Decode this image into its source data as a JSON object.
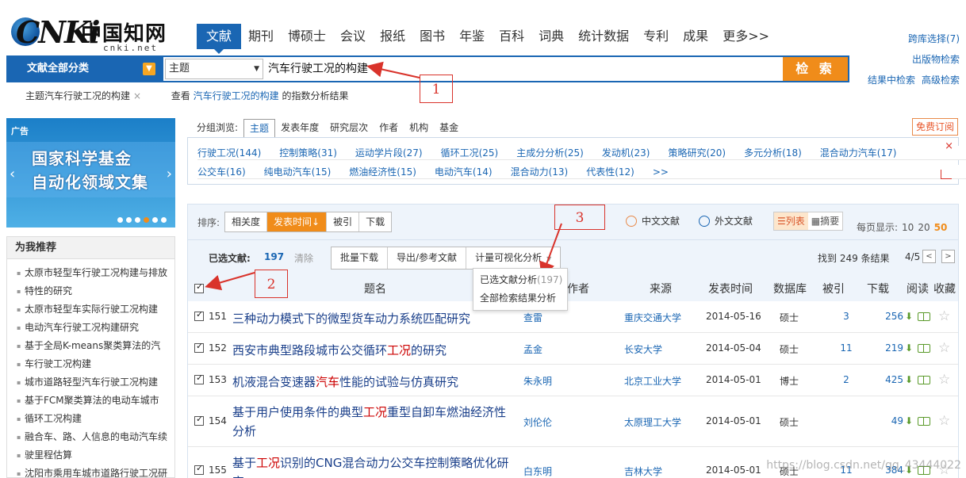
{
  "logo": {
    "latin": "CNKi",
    "chinese": "中国知网",
    "domain": "cnki.net"
  },
  "nav": [
    {
      "label": "文献",
      "active": true
    },
    {
      "label": "期刊"
    },
    {
      "label": "博硕士"
    },
    {
      "label": "会议"
    },
    {
      "label": "报纸"
    },
    {
      "label": "图书"
    },
    {
      "label": "年鉴"
    },
    {
      "label": "百科"
    },
    {
      "label": "词典"
    },
    {
      "label": "统计数据"
    },
    {
      "label": "专利"
    },
    {
      "label": "成果"
    },
    {
      "label": "更多>>"
    }
  ],
  "right_links": {
    "cross": "跨库选择(7)",
    "publication": "出版物检索",
    "within": "结果中检索",
    "advanced": "高级检索"
  },
  "search": {
    "category": "文献全部分类",
    "field": "主题",
    "query": "汽车行驶工况的构建",
    "button": "检 索"
  },
  "subline": {
    "topic_prefix": "主题",
    "topic_query": "汽车行驶工况的构建",
    "close": "×",
    "view_prefix": "查看",
    "view_query": "汽车行驶工况的构建",
    "view_suffix": "的指数分析结果"
  },
  "annotations": [
    "1",
    "2",
    "3"
  ],
  "ad": {
    "tag": "广告",
    "line1": "国家科学基金",
    "line2": "自动化领域文集"
  },
  "recommend": {
    "title": "为我推荐",
    "items": [
      "太原市轻型车行驶工况构建与排放",
      "特性的研究",
      "太原市轻型车实际行驶工况构建",
      "电动汽车行驶工况构建研究",
      "基于全局K-means聚类算法的汽",
      "车行驶工况构建",
      "城市道路轻型汽车行驶工况构建",
      "基于FCM聚类算法的电动车城市",
      "循环工况构建",
      "融合车、路、人信息的电动汽车续",
      "驶里程估算",
      "沈阳市乘用车城市道路行驶工况研"
    ]
  },
  "group": {
    "label": "分组浏览:",
    "tabs": [
      "主题",
      "发表年度",
      "研究层次",
      "作者",
      "机构",
      "基金"
    ],
    "subscribe": "免费订阅",
    "row1": [
      "行驶工况(144)",
      "控制策略(31)",
      "运动学片段(27)",
      "循环工况(25)",
      "主成分分析(25)",
      "发动机(23)",
      "策略研究(20)",
      "多元分析(18)",
      "混合动力汽车(17)"
    ],
    "row2": [
      "公交车(16)",
      "纯电动汽车(15)",
      "燃油经济性(15)",
      "电动汽车(14)",
      "混合动力(13)",
      "代表性(12)",
      ">>"
    ],
    "close": "×"
  },
  "sort": {
    "label": "排序:",
    "options": [
      {
        "label": "相关度"
      },
      {
        "label": "发表时间↓",
        "active": true
      },
      {
        "label": "被引"
      },
      {
        "label": "下载"
      }
    ],
    "chinese_docs": "中文文献",
    "foreign_docs": "外文文献",
    "view_list": "☰列表",
    "view_abstract": "▦摘要",
    "per_page_label": "每页显示:",
    "per_page": [
      "10",
      "20",
      "50"
    ],
    "per_page_active": "50"
  },
  "selection": {
    "label": "已选文献:",
    "count": "197",
    "clear": "清除",
    "batch_download": "批量下载",
    "export": "导出/参考文献",
    "visual": "计量可视化分析",
    "found": "找到 249 条结果",
    "page": "4/5",
    "prev": "<",
    "next": ">"
  },
  "dropdown": {
    "selected": "已选文献分析",
    "selected_count": "(197)",
    "all": "全部检索结果分析"
  },
  "table": {
    "headers": {
      "title": "题名",
      "author": "作者",
      "source": "来源",
      "date": "发表时间",
      "db": "数据库",
      "cite": "被引",
      "download": "下载",
      "read": "阅读",
      "fav": "收藏"
    },
    "rows": [
      {
        "num": "151",
        "title": "三种动力模式下的微型货车动力系统匹配研究",
        "hl": "",
        "author": "查雷",
        "source": "重庆交通大学",
        "date": "2014-05-16",
        "db": "硕士",
        "cite": "3",
        "dl": "256"
      },
      {
        "num": "152",
        "title": "西安市典型路段城市公交循环工况的研究",
        "hl": "工况",
        "author": "孟金",
        "source": "长安大学",
        "date": "2014-05-04",
        "db": "硕士",
        "cite": "11",
        "dl": "219"
      },
      {
        "num": "153",
        "title": "机液混合变速器汽车性能的试验与仿真研究",
        "hl": "汽车",
        "author": "朱永明",
        "source": "北京工业大学",
        "date": "2014-05-01",
        "db": "博士",
        "cite": "2",
        "dl": "425"
      },
      {
        "num": "154",
        "title": "基于用户使用条件的典型工况重型自卸车燃油经济性分析",
        "hl": "工况",
        "author": "刘伦伦",
        "source": "太原理工大学",
        "date": "2014-05-01",
        "db": "硕士",
        "cite": "",
        "dl": "49"
      },
      {
        "num": "155",
        "title": "基于工况识别的CNG混合动力公交车控制策略优化研究",
        "hl": "工况",
        "author": "白东明",
        "source": "吉林大学",
        "date": "2014-05-01",
        "db": "硕士",
        "cite": "11",
        "dl": "384"
      }
    ]
  },
  "watermark": "https://blog.csdn.net/qq_43444022",
  "colors": {
    "brand": "#1a66b3",
    "accent": "#f08c1a",
    "annotation": "#d9332b"
  }
}
